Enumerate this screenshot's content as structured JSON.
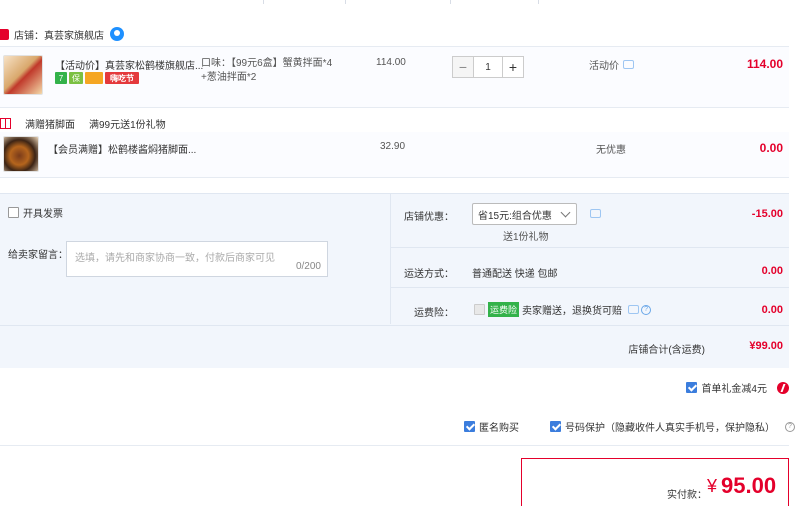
{
  "store": {
    "label": "店铺：",
    "name": "真芸家旗舰店"
  },
  "item1": {
    "title": "【活动价】真芸家松鹤楼旗舰店...",
    "tag_label": "嗨吃节",
    "sku_line1": "口味：【99元6盒】蟹黄拌面*4",
    "sku_line2": "+葱油拌面*2",
    "price": "114.00",
    "quantity": "1",
    "promo": "活动价",
    "total": "114.00"
  },
  "gift": {
    "label": "满赠猪脚面",
    "desc": "满99元送1份礼物"
  },
  "item2": {
    "title": "【会员满赠】松鹤楼酱焖猪脚面...",
    "price": "32.90",
    "promo": "无优惠",
    "total": "0.00"
  },
  "options": {
    "invoice_label": "开具发票",
    "memo_label": "给卖家留言：",
    "memo_placeholder": "选填，请先和商家协商一致，付款后商家可见",
    "memo_count": "0/200",
    "discount_label": "店铺优惠：",
    "discount_selected": "省15元:组合优惠",
    "discount_note": "送1份礼物",
    "discount_amount": "-15.00",
    "shipping_label": "运送方式：",
    "shipping_value": "普通配送 快递 包邮",
    "shipping_amount": "0.00",
    "insurance_label": "运费险：",
    "insurance_tag": "运费险",
    "insurance_text": "卖家赠送，退换货可赔",
    "insurance_amount": "0.00"
  },
  "store_total": {
    "label": "店铺合计(含运费)",
    "amount": "¥99.00"
  },
  "first_order": {
    "label": "首单礼金减4元"
  },
  "privacy": {
    "anonymous_label": "匿名购买",
    "phone_label": "号码保护（隐藏收件人真实手机号，保护隐私）"
  },
  "payment": {
    "label": "实付款：",
    "yen": "¥",
    "amount": "95.00"
  },
  "colors": {
    "accent": "#e4002b",
    "checkbox": "#3b7ddd",
    "panel": "#f2f6fc"
  }
}
